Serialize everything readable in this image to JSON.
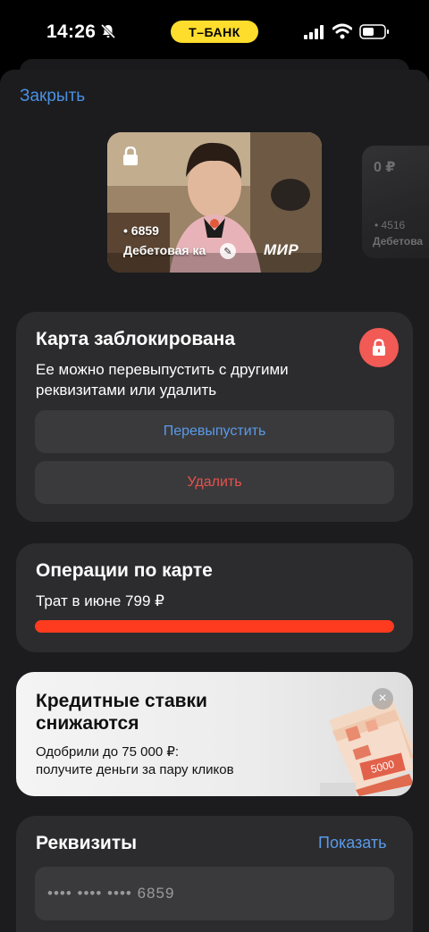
{
  "status_bar": {
    "time": "14:26",
    "bank_label": "Т–БАНК"
  },
  "header": {
    "close_label": "Закрыть"
  },
  "cards": {
    "main": {
      "number": "• 6859",
      "type": "Дебетовая ка",
      "payment_system": "МИР"
    },
    "side": {
      "balance": "0 ₽",
      "number": "• 4516",
      "type": "Дебетова"
    }
  },
  "blocked": {
    "title": "Карта заблокирована",
    "description_line1": "Ее можно перевыпустить с другими",
    "description_line2": "реквизитами или удалить",
    "reissue_label": "Перевыпустить",
    "delete_label": "Удалить"
  },
  "operations": {
    "title": "Операции по карте",
    "spent_text": "Трат в июне 799 ₽",
    "progress_fraction": 1.0
  },
  "promo": {
    "title": "Кредитные ставки снижаются",
    "text_line1": "Одобрили до 75 000 ₽:",
    "text_line2": "получите деньги за пару кликов",
    "banknote_label": "5000"
  },
  "requisites": {
    "title": "Реквизиты",
    "show_label": "Показать",
    "masked_number": "•••• •••• •••• 6859"
  },
  "colors": {
    "accent_blue": "#4a90e2",
    "danger_red": "#e8524d",
    "bank_yellow": "#ffdd2d",
    "progress_red": "#ff3b1f"
  }
}
